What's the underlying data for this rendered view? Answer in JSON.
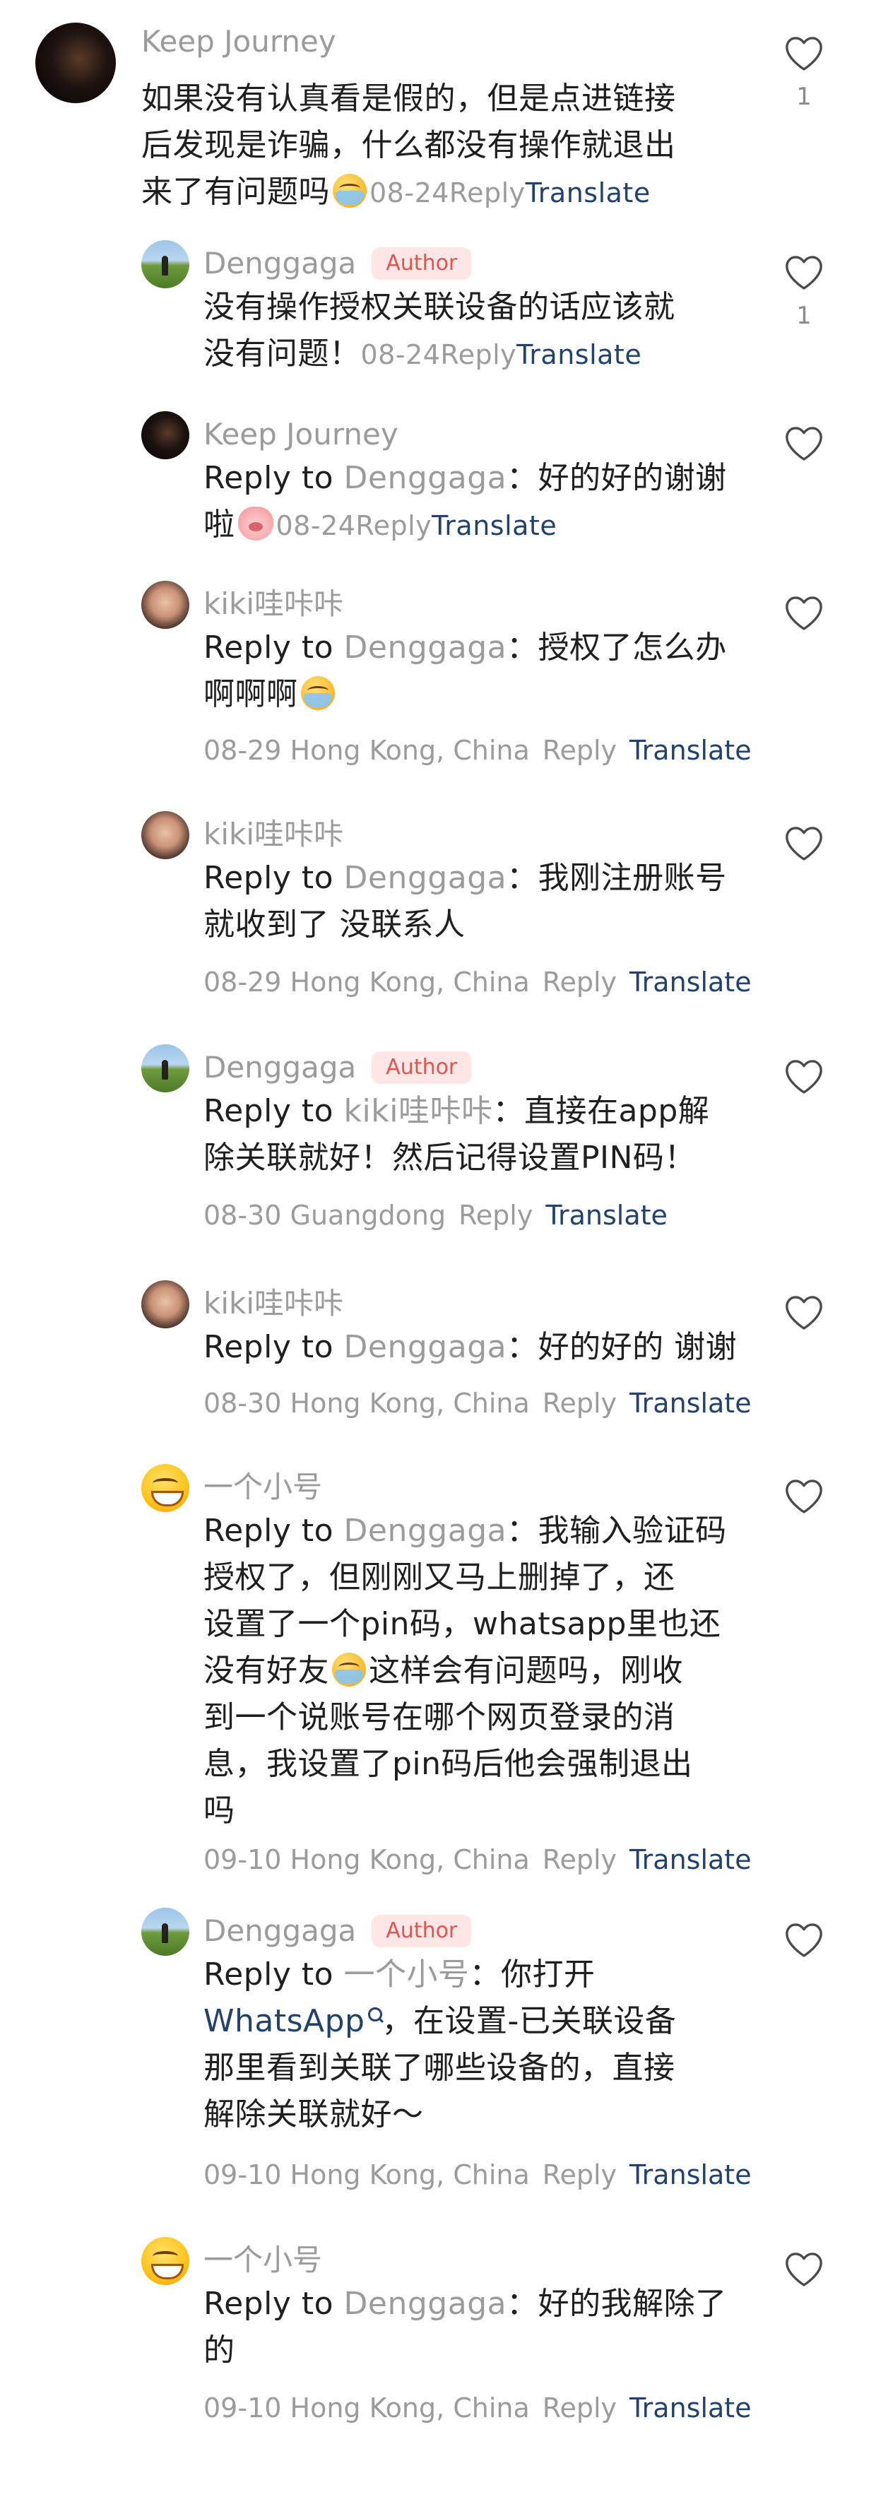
{
  "labels": {
    "reply": "Reply",
    "translate": "Translate",
    "reply_to": "Reply to",
    "author": "Author"
  },
  "comments": [
    {
      "username": "Keep Journey",
      "text_lines": [
        "如果没有认真看是假的，但是点进链接",
        "后发现是诈骗，什么都没有操作就退出",
        "来了有问题吗"
      ],
      "date": "08-24",
      "likes": "1"
    },
    {
      "username": "Denggaga",
      "text_lines": [
        "没有操作授权关联设备的话应该就",
        "没有问题！"
      ],
      "date": "08-24",
      "likes": "1"
    },
    {
      "username": "Keep Journey",
      "mention": "Denggaga",
      "text_lines": [
        "：好的好的谢谢",
        "啦"
      ],
      "date": "08-24"
    },
    {
      "username": "kiki哇咔咔",
      "mention": "Denggaga",
      "text_lines": [
        "：授权了怎么办",
        "啊啊啊"
      ],
      "meta": "08-29 Hong Kong, China"
    },
    {
      "username": "kiki哇咔咔",
      "mention": "Denggaga",
      "text_lines": [
        "：我刚注册账号",
        "就收到了 没联系人"
      ],
      "meta": "08-29 Hong Kong, China"
    },
    {
      "username": "Denggaga",
      "mention": "kiki哇咔咔",
      "text_lines": [
        "：直接在app解",
        "除关联就好！然后记得设置PIN码！"
      ],
      "meta": "08-30 Guangdong"
    },
    {
      "username": "kiki哇咔咔",
      "mention": "Denggaga",
      "text_lines": [
        "：好的好的 谢谢"
      ],
      "meta": "08-30 Hong Kong, China"
    },
    {
      "username": "一个小号",
      "mention": "Denggaga",
      "text_lines": [
        "：我输入验证码",
        "授权了，但刚刚又马上删掉了，还",
        "设置了一个pin码，whatsapp里也还",
        "没有好友",
        "这样会有问题吗，刚收",
        "到一个说账号在哪个网页登录的消",
        "息，我设置了pin码后他会强制退出",
        "吗"
      ],
      "meta": "09-10 Hong Kong, China"
    },
    {
      "username": "Denggaga",
      "mention": "一个小号",
      "text_lines": [
        "：你打开",
        "WhatsApp",
        "，在设置-已关联设备",
        "那里看到关联了哪些设备的，直接",
        "解除关联就好～"
      ],
      "meta": "09-10 Hong Kong, China"
    },
    {
      "username": "一个小号",
      "mention": "Denggaga",
      "text_lines": [
        "：好的我解除了",
        "的"
      ],
      "meta": "09-10 Hong Kong, China"
    }
  ]
}
